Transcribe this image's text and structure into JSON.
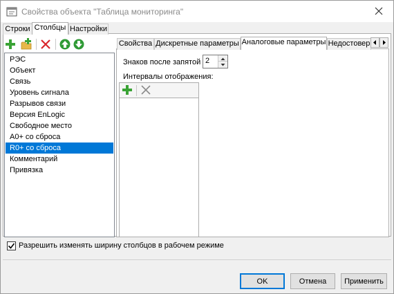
{
  "window": {
    "title": "Свойства объекта \"Таблица мониторинга\""
  },
  "tabs": [
    {
      "label": "Строки",
      "active": false
    },
    {
      "label": "Столбцы",
      "active": true
    },
    {
      "label": "Настройки",
      "active": false
    }
  ],
  "left_toolbar": {
    "buttons": [
      "add-icon",
      "add-folder-icon",
      "delete-icon",
      "move-up-icon",
      "move-down-icon"
    ]
  },
  "columns_list": {
    "items": [
      "РЭС",
      "Объект",
      "Связь",
      "Уровень сигнала",
      "Разрывов связи",
      "Версия EnLogic",
      "Свободное место",
      "A0+ со сброса",
      "R0+ со сброса",
      "Комментарий",
      "Привязка"
    ],
    "selected_index": 8
  },
  "inner_tabs": [
    {
      "label": "Свойства",
      "active": false
    },
    {
      "label": "Дискретные параметры",
      "active": false
    },
    {
      "label": "Аналоговые параметры",
      "active": true
    },
    {
      "label": "Недостовер",
      "active": false
    }
  ],
  "analog": {
    "digits_label": "Знаков после запятой",
    "digits_value": "2",
    "intervals_label": "Интервалы отображения:"
  },
  "resize_checkbox": {
    "label": "Разрешить изменять ширину столбцов в рабочем режиме",
    "checked": true
  },
  "buttons": {
    "ok": "OK",
    "cancel": "Отмена",
    "apply": "Применить"
  },
  "colors": {
    "selection": "#0078d7",
    "add_green": "#3aa335",
    "delete_red": "#d9262c"
  }
}
